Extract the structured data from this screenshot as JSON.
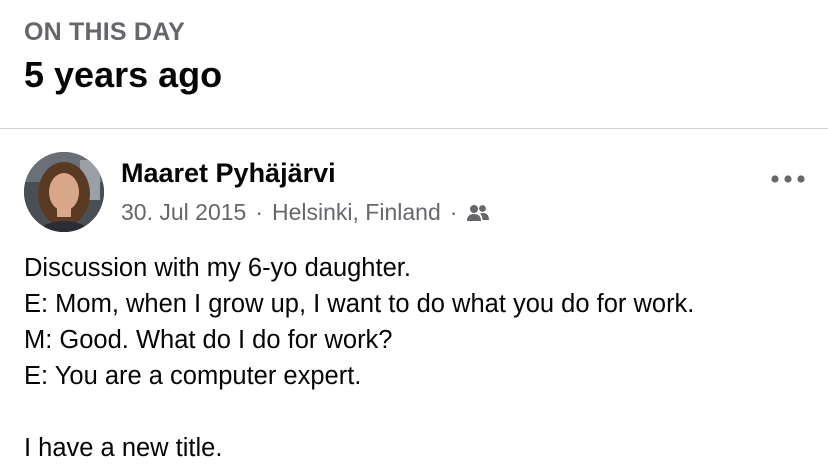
{
  "memory": {
    "label": "ON THIS DAY",
    "title": "5 years ago"
  },
  "post": {
    "author": "Maaret Pyhäjärvi",
    "date": "30. Jul 2015",
    "separator": "·",
    "location": "Helsinki, Finland",
    "audience_icon": "friends-icon",
    "more_icon": "more-options-icon",
    "lines": [
      "Discussion with my 6-yo daughter.",
      "E: Mom, when I grow up, I want to do what you do for work.",
      "M: Good. What do I do for work?",
      "E: You are a computer expert.",
      "",
      "I have a new title."
    ]
  },
  "colors": {
    "secondary_text": "#65676b",
    "primary_text": "#050505",
    "divider": "#cfd1d5"
  }
}
